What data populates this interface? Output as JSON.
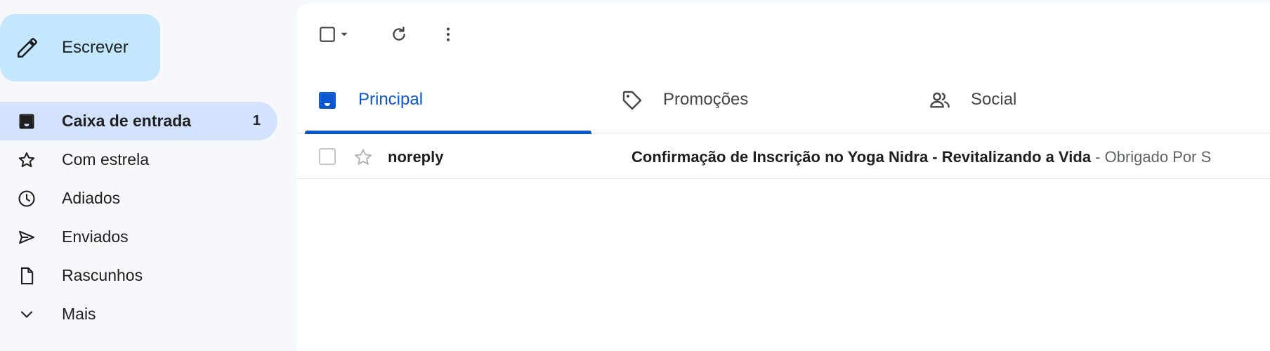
{
  "compose": {
    "label": "Escrever",
    "icon": "pencil-icon"
  },
  "nav": {
    "items": [
      {
        "label": "Caixa de entrada",
        "icon": "inbox-icon",
        "count": "1",
        "active": true
      },
      {
        "label": "Com estrela",
        "icon": "star-icon"
      },
      {
        "label": "Adiados",
        "icon": "clock-icon"
      },
      {
        "label": "Enviados",
        "icon": "send-icon"
      },
      {
        "label": "Rascunhos",
        "icon": "draft-icon"
      },
      {
        "label": "Mais",
        "icon": "chevron-down-icon"
      }
    ]
  },
  "toolbar": {
    "icons": [
      "select-checkbox-icon",
      "caret-down-icon",
      "refresh-icon",
      "more-vert-icon"
    ]
  },
  "tabs": [
    {
      "label": "Principal",
      "icon": "inbox-icon",
      "active": true
    },
    {
      "label": "Promoções",
      "icon": "tag-icon"
    },
    {
      "label": "Social",
      "icon": "people-icon"
    }
  ],
  "emails": [
    {
      "sender": "noreply",
      "subject": "Confirmação de Inscrição no Yoga Nidra - Revitalizando a Vida",
      "separator": " - ",
      "snippet": "Obrigado Por S"
    }
  ],
  "colors": {
    "accent": "#0b57d0",
    "compose_bg": "#c2e7ff",
    "active_nav_bg": "#d3e3fd",
    "page_bg": "#f6f8fc"
  }
}
